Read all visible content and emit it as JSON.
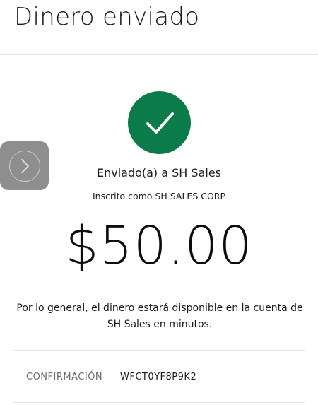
{
  "header": {
    "title": "Dinero enviado"
  },
  "status": {
    "icon": "checkmark-icon",
    "color": "#0b7b4a"
  },
  "side_button": {
    "icon": "chevron-right-icon"
  },
  "recipient": {
    "sent_to": "Enviado(a) a SH Sales",
    "enrolled_as": "Inscrito como SH SALES CORP"
  },
  "amount": "$50.00",
  "availability_note": "Por lo general, el dinero estará disponible en la cuenta de SH Sales en minutos.",
  "confirmation": {
    "label": "CONFIRMACIÓN",
    "value": "WFCT0YF8P9K2"
  }
}
